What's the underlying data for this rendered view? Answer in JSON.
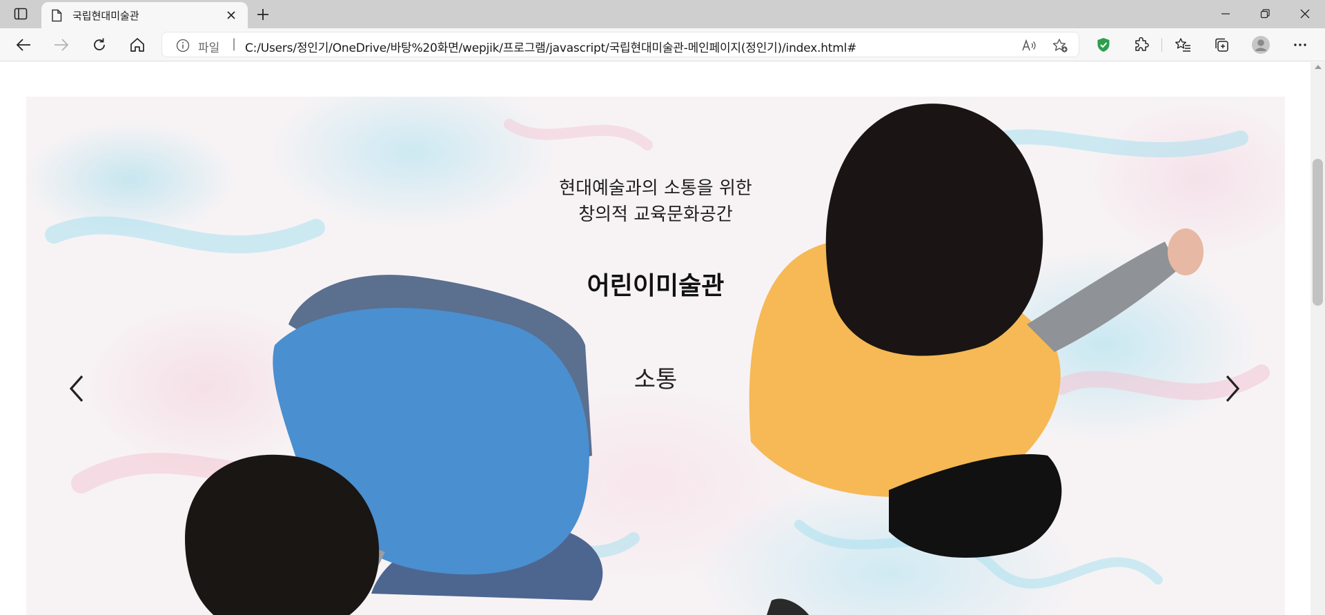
{
  "browser": {
    "tab": {
      "title": "국립현대미술관"
    },
    "address": {
      "scheme_label": "파일",
      "separator": "|",
      "url": "C:/Users/정인기/OneDrive/바탕%20화면/wepjik/프로그램/javascript/국립현대미술관-메인페이지(정인기)/index.html#"
    }
  },
  "hero": {
    "tagline_line1": "현대예술과의 소통을 위한",
    "tagline_line2": "창의적 교육문화공간",
    "title": "어린이미술관",
    "slide_word": "소통"
  },
  "colors": {
    "shirt_blue": "#4a8fd0",
    "shirt_yellow": "#f6b955",
    "chrome_bg": "#cfcfcf",
    "toolbar_bg": "#f7f7f7",
    "shield_green": "#2e9e4f"
  }
}
